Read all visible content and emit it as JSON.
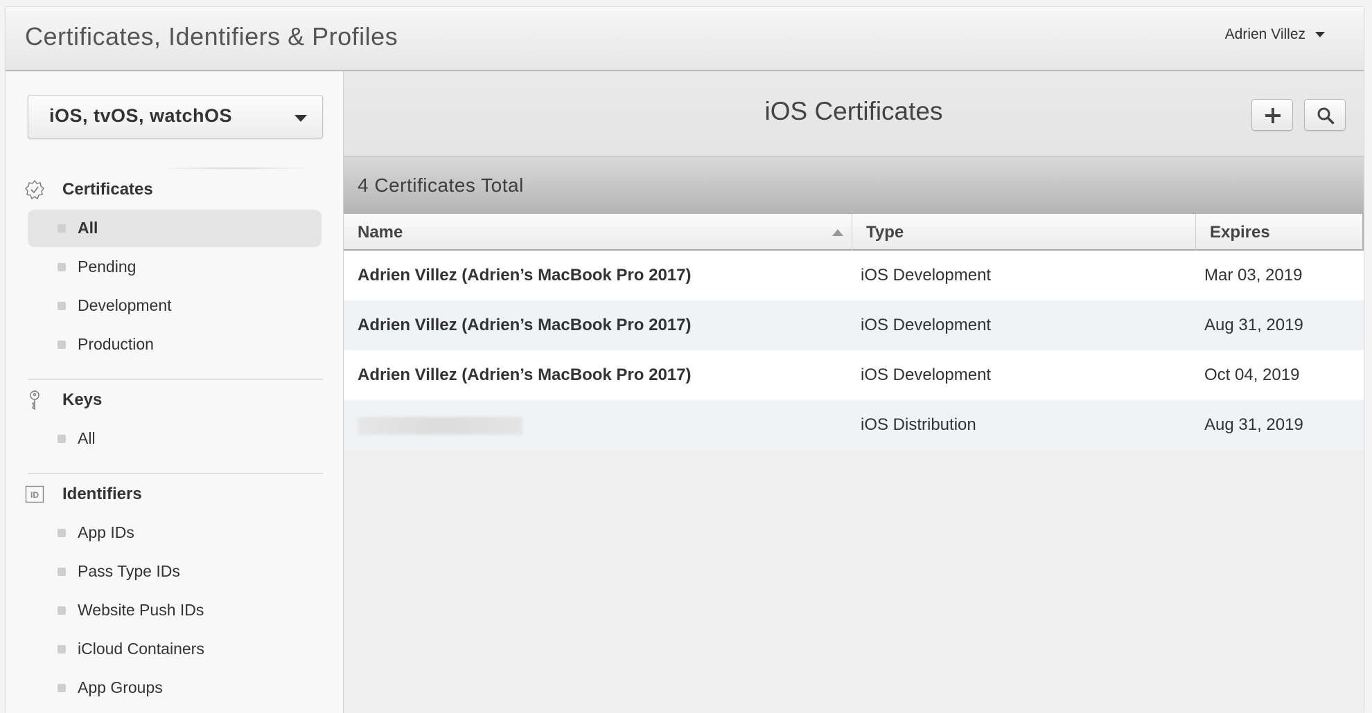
{
  "header": {
    "title": "Certificates, Identifiers & Profiles",
    "user_name": "Adrien Villez"
  },
  "sidebar": {
    "platform": "iOS, tvOS, watchOS",
    "sections": [
      {
        "title": "Certificates",
        "icon": "certificate-badge-icon",
        "items": [
          "All",
          "Pending",
          "Development",
          "Production"
        ],
        "active": "All"
      },
      {
        "title": "Keys",
        "icon": "key-icon",
        "items": [
          "All"
        ]
      },
      {
        "title": "Identifiers",
        "icon": "id-icon",
        "items": [
          "App IDs",
          "Pass Type IDs",
          "Website Push IDs",
          "iCloud Containers",
          "App Groups"
        ]
      }
    ]
  },
  "main": {
    "title": "iOS Certificates",
    "add_button_icon": "plus-icon",
    "search_button_icon": "search-icon",
    "summary": "4 Certificates Total",
    "table": {
      "columns": [
        "Name",
        "Type",
        "Expires"
      ],
      "sorted_column": "Name",
      "rows": [
        {
          "name": "Adrien Villez (Adrien’s MacBook Pro 2017)",
          "type": "iOS Development",
          "expires": "Mar 03, 2019"
        },
        {
          "name": "Adrien Villez (Adrien’s MacBook Pro 2017)",
          "type": "iOS Development",
          "expires": "Aug 31, 2019"
        },
        {
          "name": "Adrien Villez (Adrien’s MacBook Pro 2017)",
          "type": "iOS Development",
          "expires": "Oct 04, 2019"
        },
        {
          "name": "",
          "type": "iOS Distribution",
          "expires": "Aug 31, 2019"
        }
      ]
    }
  },
  "colors": {
    "row_alt": "#f0f3f6",
    "summary_bar": "#c4c4c4",
    "active_nav": "#e4e4e4"
  }
}
